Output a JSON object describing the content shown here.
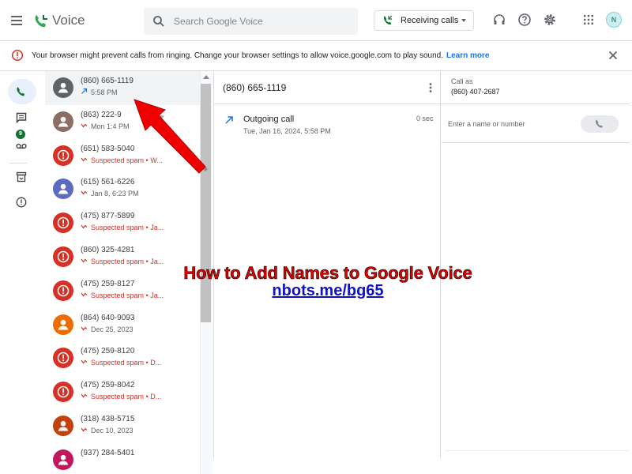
{
  "app": {
    "name": "Voice",
    "search_placeholder": "Search Google Voice",
    "receiving_label": "Receiving calls",
    "account_initial": "N"
  },
  "banner": {
    "message": "Your browser might prevent calls from ringing. Change your browser settings to allow voice.google.com to play sound.",
    "learn_more": "Learn more"
  },
  "rail": {
    "voicemail_badge": "9"
  },
  "colors": {
    "accent_green": "#137333",
    "spam_red": "#d93025",
    "link_blue": "#1a73e8"
  },
  "calls": [
    {
      "number": "(860) 665-1119",
      "detail": "5:58 PM",
      "direction": "outgoing",
      "spam": false,
      "avatar_color": "#5f6368",
      "avatar": "person"
    },
    {
      "number": "(863) 222-9",
      "detail": "Mon 1:4 PM",
      "direction": "missed",
      "spam": false,
      "avatar_color": "#8d6e63",
      "avatar": "person"
    },
    {
      "number": "(651) 583-5040",
      "detail": "Suspected spam • W...",
      "direction": "missed",
      "spam": true,
      "avatar_color": "#d93025",
      "avatar": "spam"
    },
    {
      "number": "(615) 561-6226",
      "detail": "Jan 8, 6:23 PM",
      "direction": "missed",
      "spam": false,
      "avatar_color": "#5c6bc0",
      "avatar": "person"
    },
    {
      "number": "(475) 877-5899",
      "detail": "Suspected spam • Ja...",
      "direction": "missed",
      "spam": true,
      "avatar_color": "#d93025",
      "avatar": "spam"
    },
    {
      "number": "(860) 325-4281",
      "detail": "Suspected spam • Ja...",
      "direction": "missed",
      "spam": true,
      "avatar_color": "#d93025",
      "avatar": "spam"
    },
    {
      "number": "(475) 259-8127",
      "detail": "Suspected spam • Ja...",
      "direction": "missed",
      "spam": true,
      "avatar_color": "#d93025",
      "avatar": "spam"
    },
    {
      "number": "(864) 640-9093",
      "detail": "Dec 25, 2023",
      "direction": "missed",
      "spam": false,
      "avatar_color": "#ef6c00",
      "avatar": "person"
    },
    {
      "number": "(475) 259-8120",
      "detail": "Suspected spam • D...",
      "direction": "missed",
      "spam": true,
      "avatar_color": "#d93025",
      "avatar": "spam"
    },
    {
      "number": "(475) 259-8042",
      "detail": "Suspected spam • D...",
      "direction": "missed",
      "spam": true,
      "avatar_color": "#d93025",
      "avatar": "spam"
    },
    {
      "number": "(318) 438-5715",
      "detail": "Dec 10, 2023",
      "direction": "missed",
      "spam": false,
      "avatar_color": "#c2410c",
      "avatar": "person"
    },
    {
      "number": "(937) 284-5401",
      "detail": "",
      "direction": "missed",
      "spam": false,
      "avatar_color": "#c2185b",
      "avatar": "person"
    }
  ],
  "detail": {
    "number": "(860) 665-1119",
    "call_type": "Outgoing call",
    "date": "Tue, Jan 16, 2024, 5:58 PM",
    "duration": "0 sec"
  },
  "call_panel": {
    "call_as_label": "Call as",
    "call_as_number": "(860) 407-2687",
    "input_placeholder": "Enter a name or number"
  },
  "overlay": {
    "title": "How to Add Names to Google Voice",
    "link": "nbots.me/bg65"
  }
}
